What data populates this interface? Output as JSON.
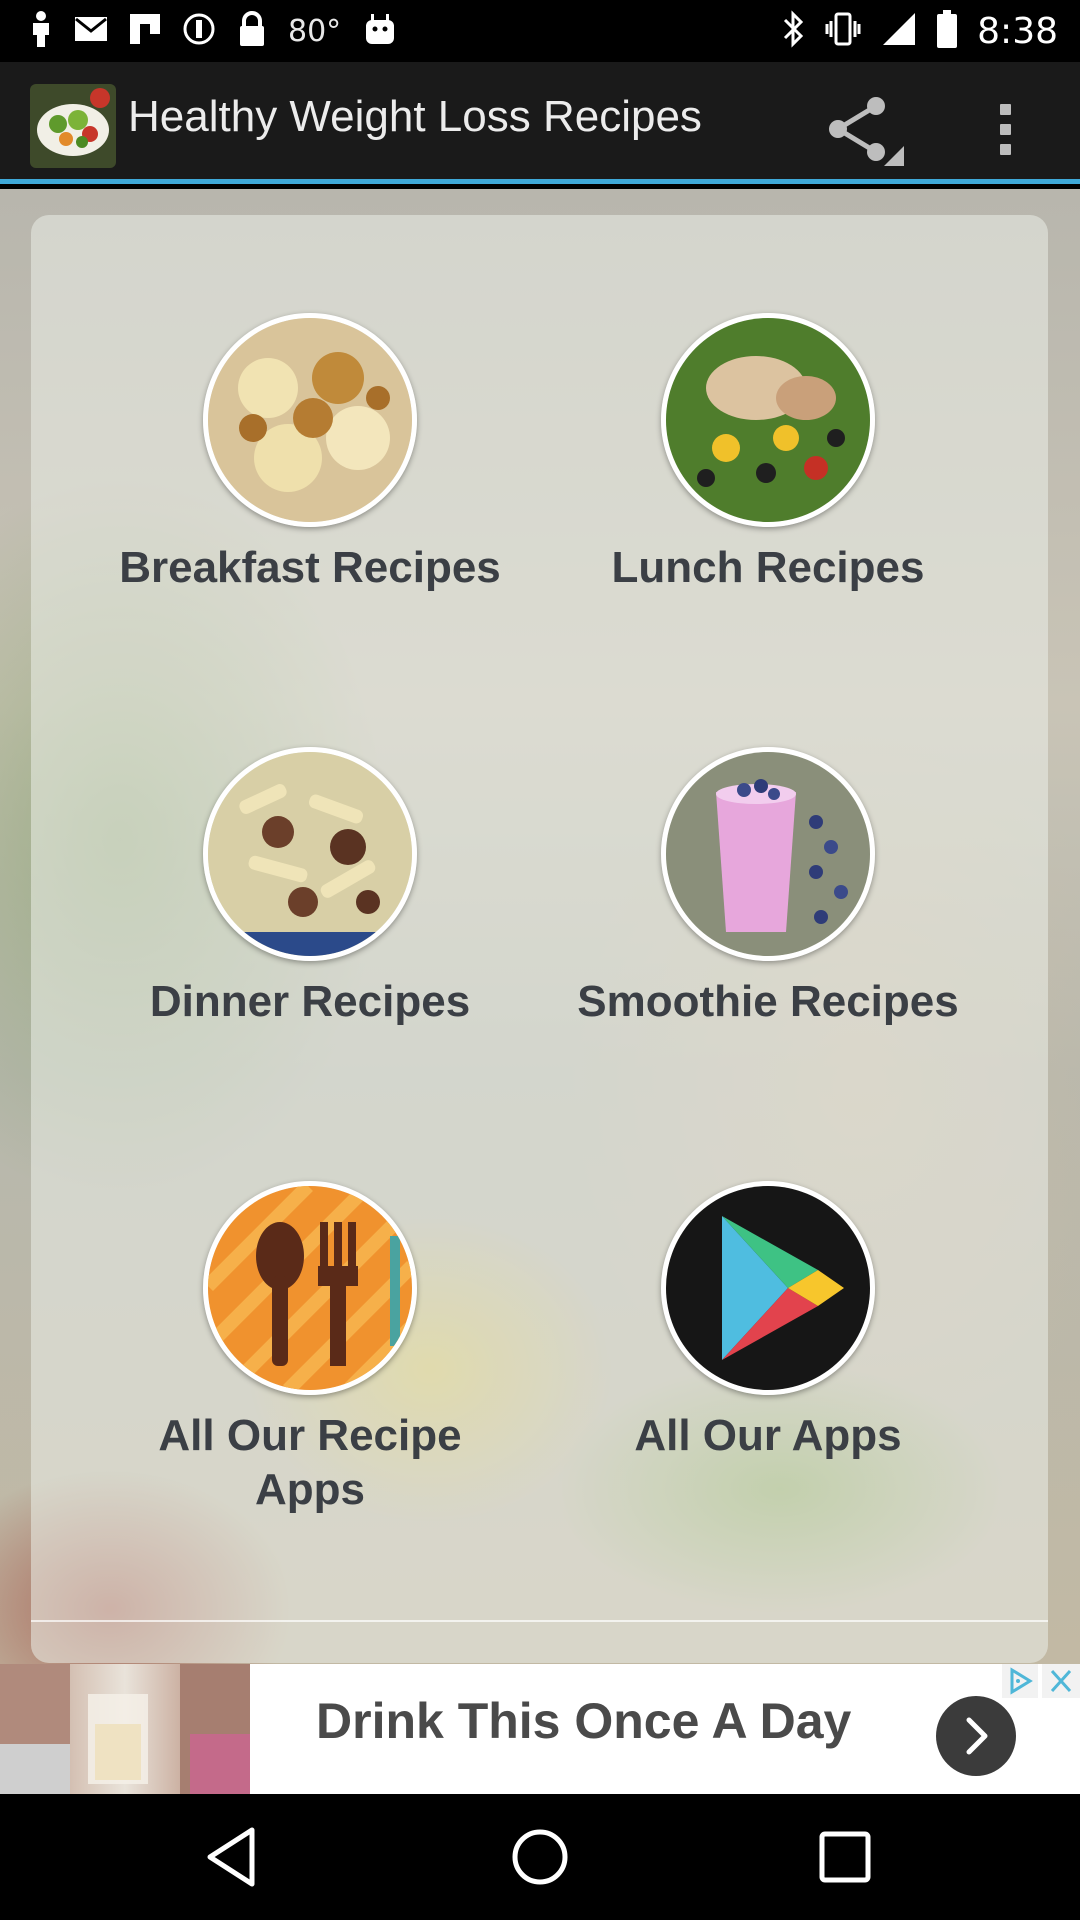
{
  "status_bar": {
    "temperature": "80°",
    "time": "8:38"
  },
  "action_bar": {
    "title": "Healthy Weight Loss Recipes",
    "accent_color": "#3fa9d8"
  },
  "tiles": [
    {
      "label": "Breakfast Recipes",
      "image": "breakfast-food-image"
    },
    {
      "label": "Lunch Recipes",
      "image": "lunch-salad-image"
    },
    {
      "label": "Dinner Recipes",
      "image": "dinner-pasta-image"
    },
    {
      "label": "Smoothie Recipes",
      "image": "smoothie-image"
    },
    {
      "label": "All Our Recipe Apps",
      "image": "spoon-fork-icon"
    },
    {
      "label": "All Our Apps",
      "image": "play-store-icon"
    }
  ],
  "ad_banner": {
    "text": "Drink This Once A Day"
  }
}
